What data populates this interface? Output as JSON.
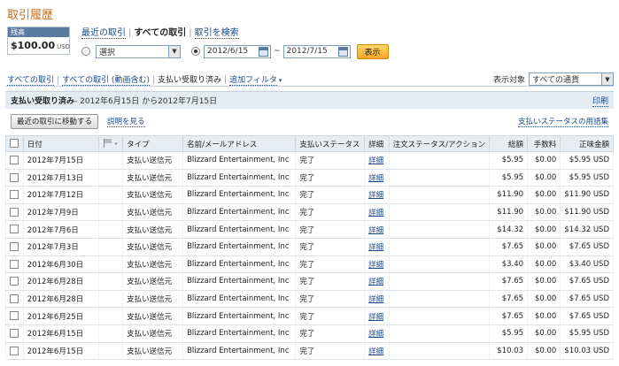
{
  "page": {
    "title": "取引履歴"
  },
  "balance": {
    "label": "残高",
    "amount": "$100.00",
    "currency": "USD"
  },
  "topnav": {
    "recent": "最近の取引",
    "all": "すべての取引",
    "search": "取引を検索"
  },
  "filter": {
    "select_value": "選択",
    "date_from": "2012/6/15",
    "tilde": "~",
    "date_to": "2012/7/15",
    "show_button": "表示"
  },
  "subnav": {
    "all": "すべての取引",
    "all_incl_video": "すべての取引 (動画含む)",
    "current": "支払い受取り済み",
    "add_filter": "追加フィルタ"
  },
  "display_target": {
    "label": "表示対象",
    "value": "すべての通貨"
  },
  "panel": {
    "heading_strong": "支払い受取り済み",
    "heading_rest": " - 2012年6月15日 から2012年7月15日",
    "print": "印刷"
  },
  "actions": {
    "move_recent": "最近の取引に移動する",
    "show_help": "説明を見る",
    "glossary": "支払いステータスの用語集"
  },
  "table": {
    "headers": {
      "date": "日付",
      "type": "タイプ",
      "name_email": "名前/メールアドレス",
      "status": "支払いステータス",
      "details": "詳細",
      "order_status": "注文ステータス/アクション",
      "gross": "総額",
      "fee": "手数料",
      "net": "正味金額"
    },
    "rows": [
      {
        "date": "2012年7月15日",
        "type": "支払い送信元",
        "name": "Blizzard Entertainment, Inc",
        "status": "完了",
        "detail": "詳細",
        "gross": "$5.95",
        "fee": "$0.00",
        "net": "$5.95 USD"
      },
      {
        "date": "2012年7月13日",
        "type": "支払い送信元",
        "name": "Blizzard Entertainment, Inc",
        "status": "完了",
        "detail": "詳細",
        "gross": "$5.95",
        "fee": "$0.00",
        "net": "$5.95 USD"
      },
      {
        "date": "2012年7月12日",
        "type": "支払い送信元",
        "name": "Blizzard Entertainment, Inc",
        "status": "完了",
        "detail": "詳細",
        "gross": "$11.90",
        "fee": "$0.00",
        "net": "$11.90 USD"
      },
      {
        "date": "2012年7月9日",
        "type": "支払い送信元",
        "name": "Blizzard Entertainment, Inc",
        "status": "完了",
        "detail": "詳細",
        "gross": "$11.90",
        "fee": "$0.00",
        "net": "$11.90 USD"
      },
      {
        "date": "2012年7月6日",
        "type": "支払い送信元",
        "name": "Blizzard Entertainment, Inc",
        "status": "完了",
        "detail": "詳細",
        "gross": "$14.32",
        "fee": "$0.00",
        "net": "$14.32 USD"
      },
      {
        "date": "2012年7月3日",
        "type": "支払い送信元",
        "name": "Blizzard Entertainment, Inc",
        "status": "完了",
        "detail": "詳細",
        "gross": "$7.65",
        "fee": "$0.00",
        "net": "$7.65 USD"
      },
      {
        "date": "2012年6月30日",
        "type": "支払い送信元",
        "name": "Blizzard Entertainment, Inc",
        "status": "完了",
        "detail": "詳細",
        "gross": "$3.40",
        "fee": "$0.00",
        "net": "$3.40 USD"
      },
      {
        "date": "2012年6月28日",
        "type": "支払い送信元",
        "name": "Blizzard Entertainment, Inc",
        "status": "完了",
        "detail": "詳細",
        "gross": "$7.65",
        "fee": "$0.00",
        "net": "$7.65 USD"
      },
      {
        "date": "2012年6月28日",
        "type": "支払い送信元",
        "name": "Blizzard Entertainment, Inc",
        "status": "完了",
        "detail": "詳細",
        "gross": "$7.65",
        "fee": "$0.00",
        "net": "$7.65 USD"
      },
      {
        "date": "2012年6月25日",
        "type": "支払い送信元",
        "name": "Blizzard Entertainment, Inc",
        "status": "完了",
        "detail": "詳細",
        "gross": "$7.65",
        "fee": "$0.00",
        "net": "$7.65 USD"
      },
      {
        "date": "2012年6月15日",
        "type": "支払い送信元",
        "name": "Blizzard Entertainment, Inc",
        "status": "完了",
        "detail": "詳細",
        "gross": "$5.95",
        "fee": "$0.00",
        "net": "$5.95 USD"
      },
      {
        "date": "2012年6月15日",
        "type": "支払い送信元",
        "name": "Blizzard Entertainment, Inc",
        "status": "完了",
        "detail": "詳細",
        "gross": "$10.03",
        "fee": "$0.00",
        "net": "$10.03 USD"
      }
    ]
  }
}
